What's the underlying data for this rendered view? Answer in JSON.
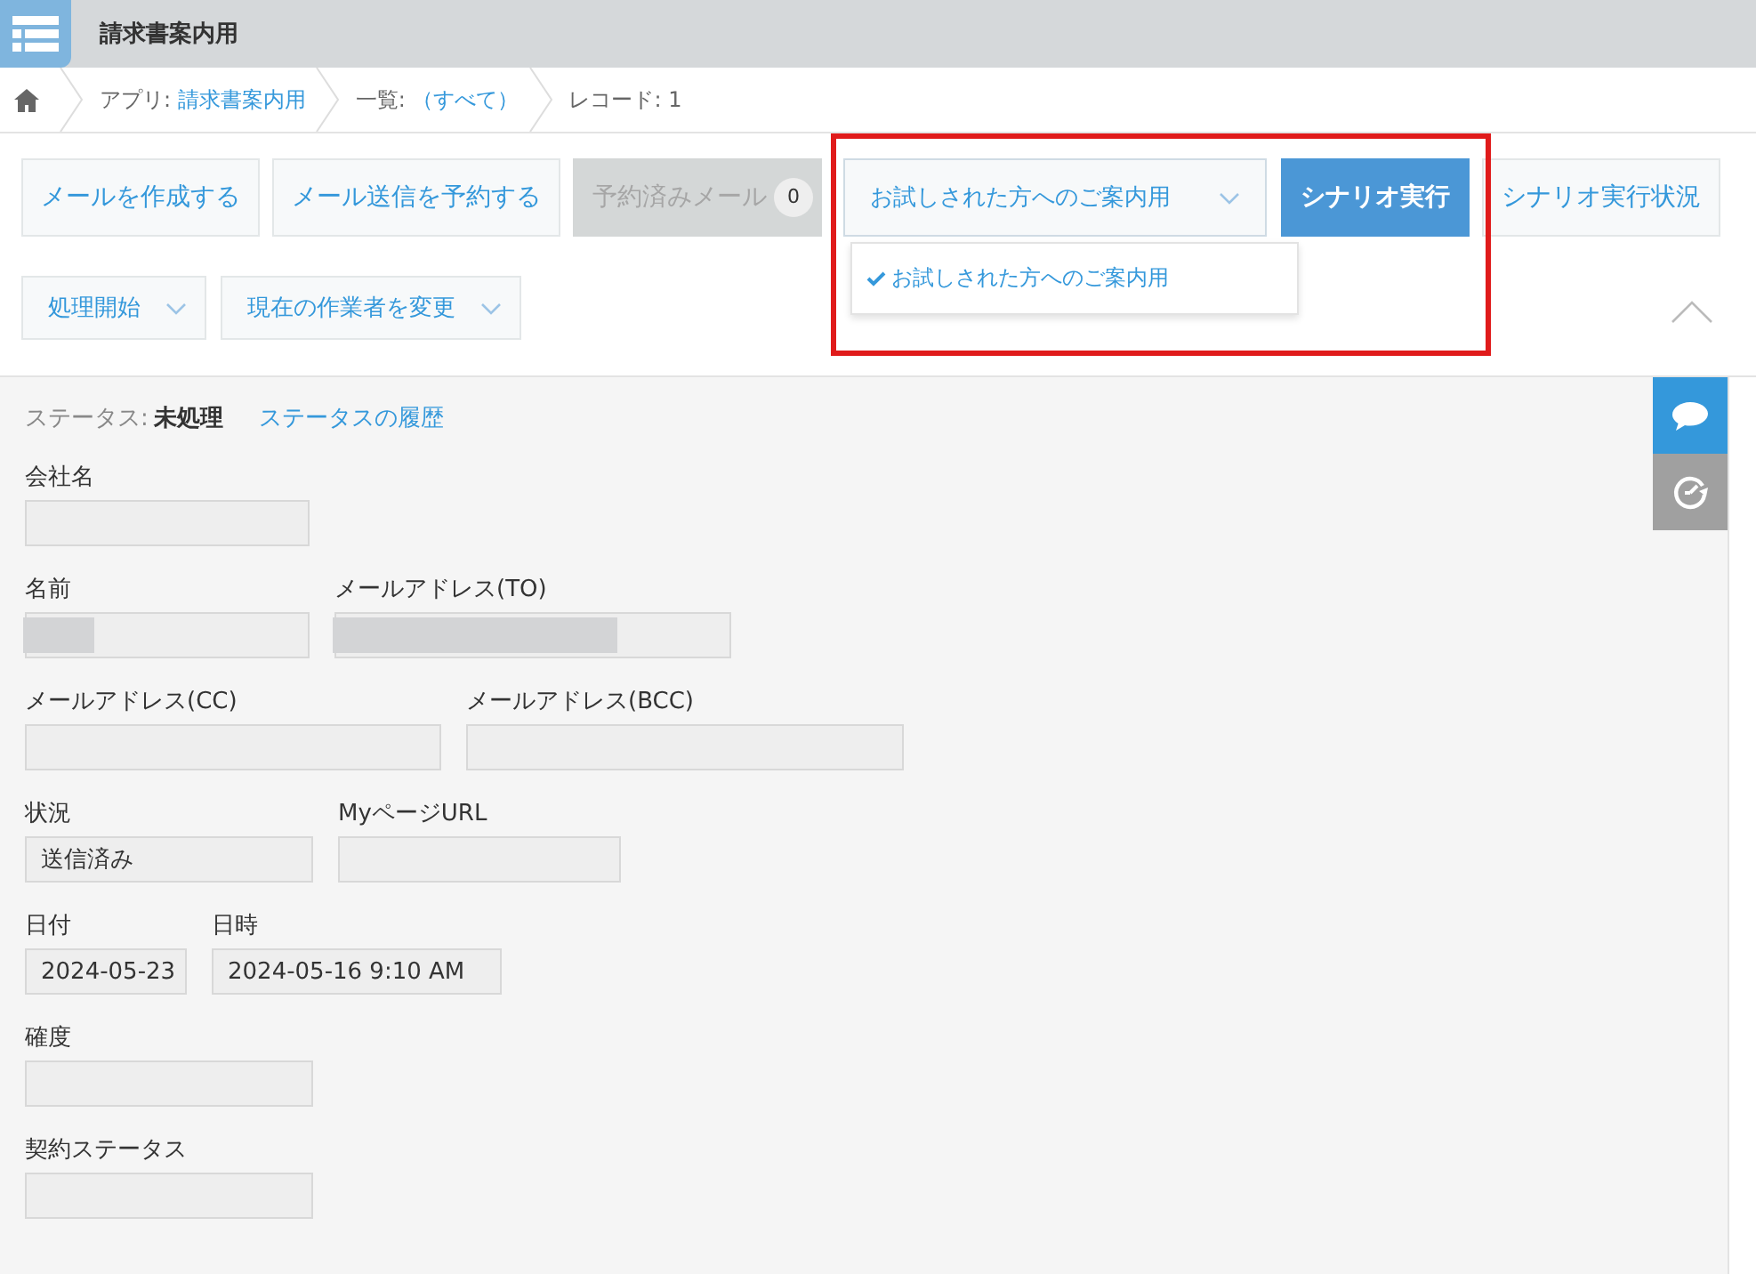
{
  "header": {
    "title": "請求書案内用"
  },
  "breadcrumb": [
    {
      "label": "アプリ: ",
      "link": "請求書案内用"
    },
    {
      "label": "一覧: ",
      "link": "（すべて）"
    },
    {
      "label": "レコード: 1"
    }
  ],
  "toolbar": {
    "buttons": [
      {
        "label": "メールを作成する",
        "disabled": false
      },
      {
        "label": "メール送信を予約する",
        "disabled": false
      },
      {
        "label": "予約済みメール",
        "disabled": true,
        "badge": "0"
      }
    ],
    "scenario": {
      "highlighted": true,
      "value": "お試しされた方へのご案内用",
      "expanded": true,
      "options": [
        {
          "label": "お試しされた方へのご案内用",
          "selected": true
        }
      ],
      "run_button": "シナリオ実行",
      "status_button": "シナリオ実行状況"
    },
    "action_menus": [
      {
        "label": "処理開始"
      },
      {
        "label": "現在の作業者を変更"
      }
    ],
    "expanded": true
  },
  "status": {
    "label": "ステータス:",
    "value": "未処理",
    "history_link": "ステータスの履歴"
  },
  "form_rows": [
    [
      {
        "label": "会社名"
      }
    ],
    [
      {
        "label": "名前",
        "redacted": true
      },
      {
        "label": "メールアドレス(TO)",
        "redacted": true
      }
    ],
    [
      {
        "label": "メールアドレス(CC)"
      },
      {
        "label": "メールアドレス(BCC)"
      }
    ],
    [
      {
        "label": "状況",
        "value": "送信済み"
      },
      {
        "label": "MyページURL"
      }
    ],
    [
      {
        "label": "日付",
        "value": "2024-05-23"
      },
      {
        "label": "日時",
        "value": "2024-05-16 9:10 AM"
      }
    ],
    [
      {
        "label": "確度"
      }
    ],
    [
      {
        "label": "契約ステータス"
      }
    ]
  ]
}
